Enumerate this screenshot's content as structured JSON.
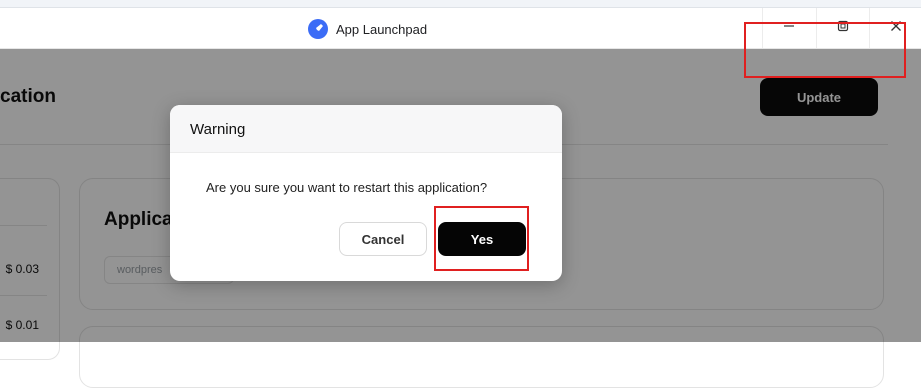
{
  "window": {
    "title": "App Launchpad",
    "logo_icon": "rocket-icon",
    "controls": [
      "minimize-icon",
      "maximize-icon",
      "close-icon"
    ]
  },
  "main": {
    "page_title": "cation",
    "update_button": "Update",
    "prices": [
      "$ 0.03",
      "$ 0.01"
    ],
    "card_title": "Applica",
    "card_input_placeholder": "wordpres"
  },
  "dialog": {
    "title": "Warning",
    "message": "Are you sure you want to restart this application?",
    "cancel_label": "Cancel",
    "yes_label": "Yes"
  },
  "colors": {
    "highlight": "#e02020",
    "primary_button": "#0b0b0b",
    "logo": "#3b6cf6"
  }
}
